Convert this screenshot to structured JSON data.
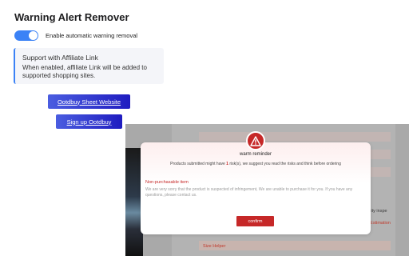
{
  "header": {
    "title": "Warning Alert Remover"
  },
  "settings": {
    "toggle_label": "Enable automatic warning removal",
    "toggle_on": true
  },
  "info": {
    "heading": "Support with Affiliate Link",
    "text": "When enabled, affiliate Link will be added to supported shopping sites."
  },
  "buttons": {
    "sheet": "Ootdbuy Sheet Website",
    "signup": "Sign up Ootdbuy"
  },
  "preview": {
    "modal_title": "warm reminder",
    "message_before": "Products submitted might have ",
    "message_count": "1",
    "message_after": " risk(s), we suggest you read the risks and think before ordering",
    "np_title": "Non-purchasable item",
    "np_text": "We are very sorry that the product is suspected of infringement, We are unable to purchase it for you. If you have any questions, please contact us.",
    "confirm_label": "confirm",
    "side_text_1": "quality inspe",
    "side_text_2": "ery Estimation",
    "side_text_3": "Size Helper"
  },
  "colors": {
    "accent": "#3b82f6",
    "button_gradient_start": "#4a5de0",
    "button_gradient_end": "#1f1cc0",
    "warning_red": "#c62828"
  },
  "icons": {
    "warning": "warning-triangle-icon"
  }
}
